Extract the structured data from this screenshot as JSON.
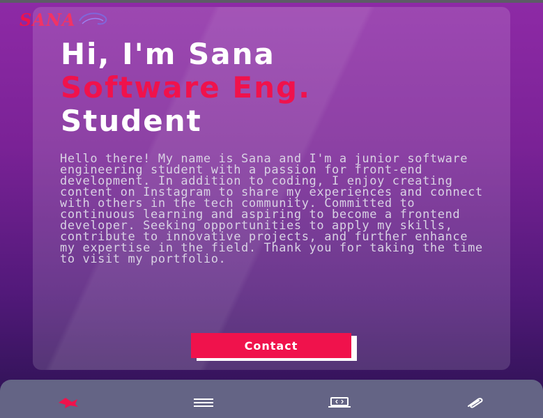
{
  "logo": {
    "text": "SANA"
  },
  "hero": {
    "greeting": "Hi, I'm Sana",
    "role": "Software Eng.",
    "role_suffix": "Student",
    "bio": "Hello there! My name is Sana and I'm a junior software engineering student with a passion for front-end development. In addition to coding, I enjoy creating content on Instagram to share my experiences and connect with others in the tech community. Committed to continuous learning and aspiring to become a frontend developer. Seeking opportunities to apply my skills, contribute to innovative projects, and further enhance my expertise in the field. Thank you for taking the time to visit my portfolio."
  },
  "cta": {
    "contact_label": "Contact"
  },
  "nav": {
    "items": [
      {
        "icon": "home-icon",
        "active": true
      },
      {
        "icon": "menu-icon",
        "active": false
      },
      {
        "icon": "laptop-code-icon",
        "active": false
      },
      {
        "icon": "paperclip-icon",
        "active": false
      }
    ]
  },
  "colors": {
    "accent": "#f0124c",
    "background_top": "#8e2aa6",
    "background_bottom": "#2a1250",
    "nav_bar": "#646485",
    "text_light": "#d9d2e4"
  }
}
